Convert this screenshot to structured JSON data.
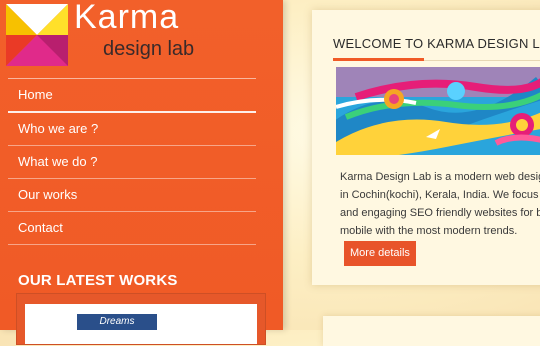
{
  "brand": {
    "name": "Karma",
    "sub": "design lab"
  },
  "nav": [
    {
      "label": "Home",
      "active": true
    },
    {
      "label": "Who we are ?"
    },
    {
      "label": "What we do ?"
    },
    {
      "label": "Our works"
    },
    {
      "label": "Contact"
    }
  ],
  "latest": {
    "title": "OUR LATEST WORKS",
    "thumb_text": "Dreams"
  },
  "welcome": {
    "title": "WELCOME TO KARMA DESIGN LAB",
    "body": [
      "Karma Design Lab is a modern web design",
      "in Cochin(kochi), Kerala, India. We focus on",
      "and engaging SEO friendly websites for b",
      "mobile with the most modern trends."
    ],
    "button": "More details"
  },
  "colors": {
    "accent": "#f05a26",
    "card_bg": "#fff8e1"
  }
}
